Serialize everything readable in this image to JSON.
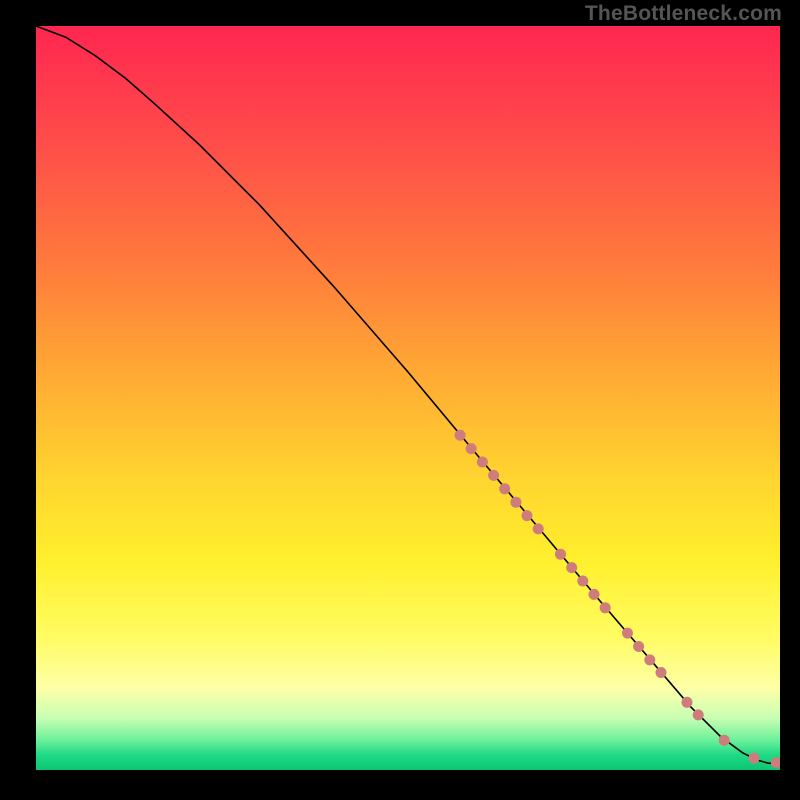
{
  "watermark": "TheBottleneck.com",
  "chart_data": {
    "type": "line",
    "title": "",
    "xlabel": "",
    "ylabel": "",
    "xlim": [
      0,
      100
    ],
    "ylim": [
      0,
      100
    ],
    "background_gradient_stops": [
      {
        "pos": 0,
        "color": "#ff2650"
      },
      {
        "pos": 15,
        "color": "#ff4b4a"
      },
      {
        "pos": 32,
        "color": "#ff7a3c"
      },
      {
        "pos": 46,
        "color": "#ffa734"
      },
      {
        "pos": 60,
        "color": "#ffd22f"
      },
      {
        "pos": 72,
        "color": "#fff02e"
      },
      {
        "pos": 82,
        "color": "#fffc61"
      },
      {
        "pos": 89,
        "color": "#feffa8"
      },
      {
        "pos": 93,
        "color": "#c8ffb3"
      },
      {
        "pos": 96,
        "color": "#6cf09a"
      },
      {
        "pos": 98,
        "color": "#1ed985"
      },
      {
        "pos": 100,
        "color": "#0bc572"
      }
    ],
    "series": [
      {
        "name": "curve",
        "x": [
          0,
          4,
          8,
          12,
          16,
          22,
          30,
          40,
          50,
          60,
          68,
          76,
          82,
          88,
          92,
          95,
          97,
          98.5,
          100
        ],
        "y": [
          100,
          98.5,
          96,
          93,
          89.5,
          84,
          76,
          65,
          53.5,
          41.5,
          32,
          22.5,
          15.5,
          8.5,
          4.5,
          2.3,
          1.3,
          0.9,
          1.0
        ]
      }
    ],
    "markers": {
      "name": "dots",
      "color": "#cf7c7c",
      "radius": 5.5,
      "points_xy": [
        [
          57,
          45.0
        ],
        [
          58.5,
          43.2
        ],
        [
          60,
          41.4
        ],
        [
          61.5,
          39.6
        ],
        [
          63,
          37.8
        ],
        [
          64.5,
          36.0
        ],
        [
          66,
          34.2
        ],
        [
          67.5,
          32.4
        ],
        [
          70.5,
          29.0
        ],
        [
          72,
          27.2
        ],
        [
          73.5,
          25.4
        ],
        [
          75,
          23.6
        ],
        [
          76.5,
          21.8
        ],
        [
          79.5,
          18.4
        ],
        [
          81,
          16.6
        ],
        [
          82.5,
          14.8
        ],
        [
          84,
          13.1
        ],
        [
          87.5,
          9.1
        ],
        [
          89,
          7.4
        ],
        [
          92.5,
          4.0
        ],
        [
          96.5,
          1.6
        ],
        [
          99.5,
          1.0
        ],
        [
          101,
          1.0
        ]
      ]
    }
  }
}
